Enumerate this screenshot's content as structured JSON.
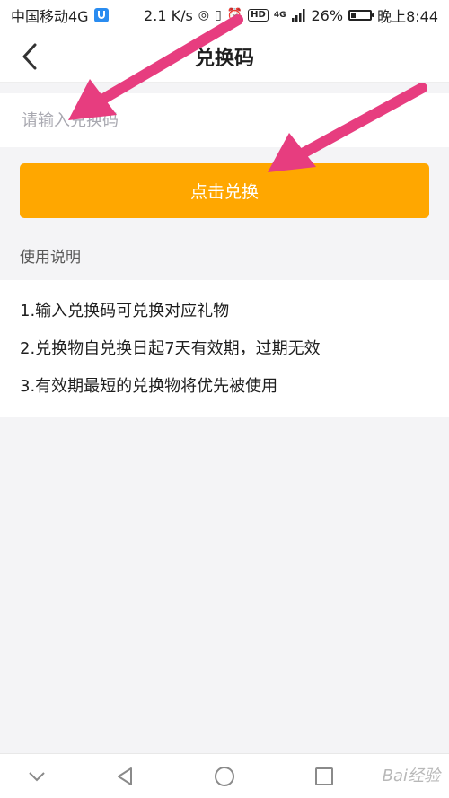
{
  "status_bar": {
    "carrier": "中国移动4G",
    "speed": "2.1 K/s",
    "battery": "26%",
    "battery_level": 0.26,
    "time": "晚上8:44",
    "network": "4G",
    "hd_label": "HD"
  },
  "header": {
    "title": "兑换码"
  },
  "redeem_input": {
    "placeholder": "请输入兑换码",
    "value": ""
  },
  "redeem_button": {
    "label": "点击兑换"
  },
  "usage": {
    "label": "使用说明",
    "items": [
      "1.输入兑换码可兑换对应礼物",
      "2.兑换物自兑换日起7天有效期，过期无效",
      "3.有效期最短的兑换物将优先被使用"
    ]
  },
  "watermark": "Bai经验",
  "colors": {
    "accent": "#ffa700",
    "arrow": "#e73d7f",
    "background": "#f4f4f6"
  },
  "icons": {
    "back": "chevron-left-icon",
    "nav_down": "chevron-down-icon",
    "nav_back": "triangle-back-icon",
    "nav_home": "circle-home-icon",
    "nav_recent": "square-recent-icon"
  }
}
